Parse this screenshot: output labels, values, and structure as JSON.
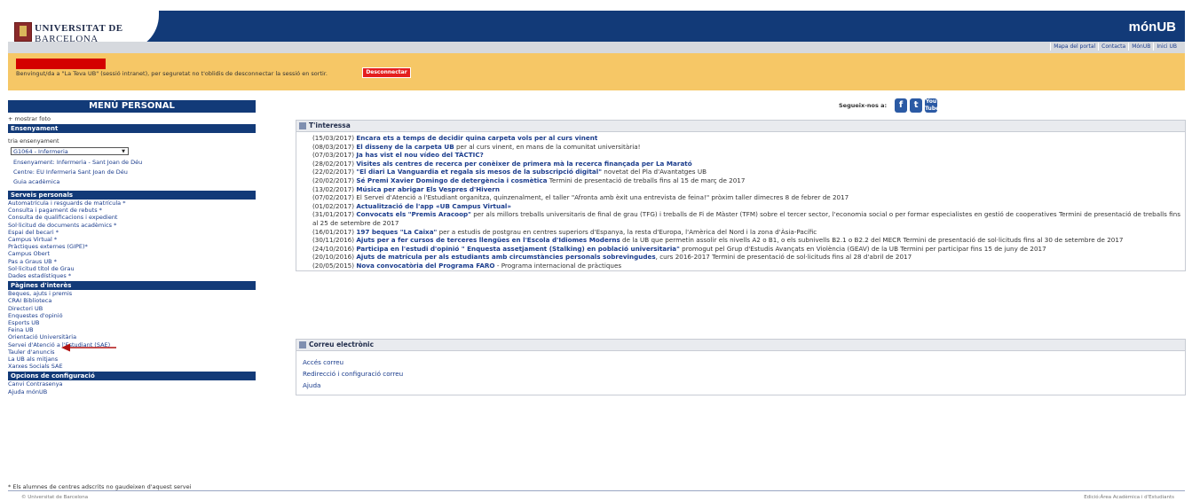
{
  "header": {
    "university_line1": "UNIVERSITAT DE",
    "university_line2": "BARCELONA",
    "brand": "mónUB",
    "links": [
      "Mapa del portal",
      "Contacta",
      "MónUB",
      "Inici UB"
    ]
  },
  "welcome": {
    "message": "Benvingut/da a \"La Teva UB\" (sessió intranet), per seguretat no t'oblidis de desconnectar la sessió en sortir.",
    "logout_label": "Desconnectar"
  },
  "menu": {
    "title": "MENÚ PERSONAL",
    "show_photo": "+ mostrar foto",
    "sections": {
      "ensenyament": {
        "title": "Ensenyament",
        "choose_label": "tria ensenyament",
        "selected": "G1064 - Infermeria",
        "info": [
          "Ensenyament: Infermeria - Sant Joan de Déu",
          "Centre: EU Infermeria Sant Joan de Déu",
          "Guia acadèmica"
        ]
      },
      "serveis": {
        "title": "Serveis personals",
        "items": [
          "Automatrícula i resguards de matrícula *",
          "Consulta i pagament de rebuts *",
          "Consulta de qualificacions i expedient",
          "Sol·licitud de documents acadèmics *",
          "Espai del becari *",
          "Campus Virtual *",
          "Pràctiques externes (GIPE)*",
          "Campus Obert",
          "Pas a Graus UB *",
          "Sol·licitud títol de Grau",
          "Dades estadístiques *"
        ]
      },
      "pagines": {
        "title": "Pàgines d'interès",
        "items": [
          "Beques, ajuts i premis",
          "CRAI Biblioteca",
          "Directori UB",
          "Enquestes d'opinió",
          "Esports UB",
          "Feina UB",
          "Orientació Universitària",
          "Servei d'Atenció a l'Estudiant (SAE)",
          "Tauler d'anuncis",
          "La UB als mitjans",
          "Xarxes Socials SAE"
        ]
      },
      "opcions": {
        "title": "Opcions de configuració",
        "items": [
          "Canvi Contrasenya",
          "Ajuda mónUB"
        ]
      }
    }
  },
  "social": {
    "label": "Segueix-nos a:",
    "icons": [
      "facebook-icon",
      "twitter-icon",
      "youtube-icon"
    ]
  },
  "news": {
    "title": "T'interessa",
    "items": [
      {
        "date": "(15/03/2017)",
        "bold": "Encara ets a temps de decidir quina carpeta vols per al curs vinent",
        "rest": ""
      },
      {
        "date": "(08/03/2017)",
        "bold": "El disseny de la carpeta UB",
        "rest": " per al curs vinent, en mans de la comunitat universitària!"
      },
      {
        "date": "(07/03/2017)",
        "bold": "Ja has vist el nou vídeo del TÀCTIC?",
        "rest": ""
      },
      {
        "date": "(28/02/2017)",
        "bold": "Visites als centres de recerca per conèixer de primera mà la recerca finançada per La Marató",
        "rest": ""
      },
      {
        "date": "(22/02/2017)",
        "bold": "\"El diari La Vanguardia et regala sis mesos de la subscripció digital\"",
        "rest": " novetat del Pla d'Avantatges UB"
      },
      {
        "date": "(20/02/2017)",
        "bold": "Sé Premi Xavier Domingo de detergència i cosmètica",
        "rest": " Termini de presentació de treballs fins al 15 de març de 2017"
      },
      {
        "date": "(13/02/2017)",
        "bold": "Música per abrigar Els Vespres d'Hivern",
        "rest": ""
      },
      {
        "date": "(07/02/2017)",
        "bold": "",
        "rest": "El Servei d'Atenció a l'Estudiant organitza, quinzenalment, el taller \"Afronta amb èxit una entrevista de feina!\" pròxim taller dimecres 8 de febrer de 2017"
      },
      {
        "date": "(01/02/2017)",
        "bold": "Actualització de l'app «UB Campus Virtual»",
        "rest": ""
      },
      {
        "date": "(31/01/2017)",
        "bold": "Convocats els \"Premis Aracoop\"",
        "rest": " per als millors treballs universitaris de final de grau (TFG) i treballs de Fi de Màster (TFM) sobre el tercer sector, l'economia social o per formar especialistes en gestió de cooperatives Termini de presentació de treballs fins al 25 de setembre de 2017"
      },
      {
        "date": "(16/01/2017)",
        "bold": "197 beques \"La Caixa\"",
        "rest": " per a estudis de postgrau en centres superiors d'Espanya, la resta d'Europa, l'Amèrica del Nord i la zona d'Àsia-Pacífic"
      },
      {
        "date": "(30/11/2016)",
        "bold": "Ajuts per a fer cursos de terceres llengües en l'Escola d'Idiomes Moderns",
        "rest": " de la UB que permetin assolir els nivells A2 o B1, o els subnivells B2.1 o B2.2 del MECR Termini de presentació de sol·licituds fins al 30 de setembre de 2017"
      },
      {
        "date": "(24/10/2016)",
        "bold": "Participa en l'estudi d'opinió \" Enquesta assetjament (Stalking) en població universitaria\"",
        "rest": " promogut pel Grup d'Estudis Avançats en Violència (GEAV) de la UB Termini per participar fins 15 de juny de 2017"
      },
      {
        "date": "(20/10/2016)",
        "bold": "Ajuts de matrícula per als estudiants amb circumstàncies personals sobrevingudes",
        "rest": ", curs 2016-2017 Termini de presentació de sol·licituds fins al 28 d'abril de 2017"
      },
      {
        "date": "(20/05/2015)",
        "bold": "Nova convocatòria del Programa FARO",
        "rest": " - Programa internacional de pràctiques"
      }
    ]
  },
  "mail": {
    "title": "Correu electrònic",
    "links": [
      "Accés correu",
      "Redirecció i configuració correu",
      "Ajuda"
    ]
  },
  "footer": {
    "note": "* Els alumnes de centres adscrits no gaudeixen d'aquest servei",
    "copyright": "© Universitat de Barcelona",
    "right": "Edició:Àrea Acadèmica i d'Estudiants"
  }
}
